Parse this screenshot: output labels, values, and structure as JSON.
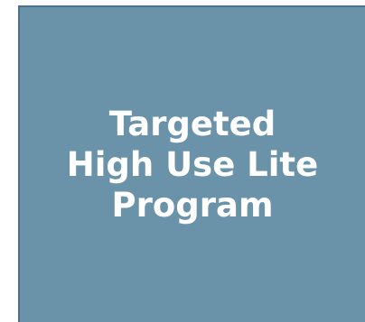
{
  "box": {
    "title_lines": [
      "Targeted",
      "High Use Lite",
      "Program"
    ],
    "fill_color": "#6a93a9",
    "border_color": "#4f7088",
    "text_color": "#ffffff"
  }
}
